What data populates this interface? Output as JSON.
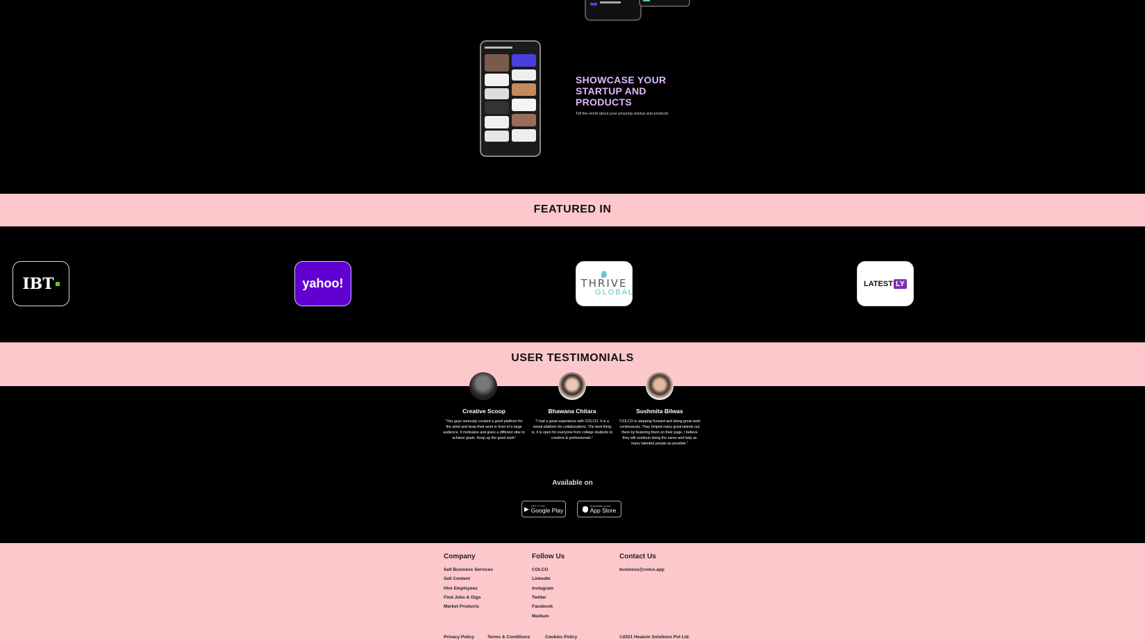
{
  "showcase": {
    "title": "SHOWCASE YOUR STARTUP AND PRODUCTS",
    "subtitle": "Tell the world about your amazing startup and products"
  },
  "featured": {
    "title": "FEATURED IN",
    "logos": [
      {
        "name": "IBT",
        "text": "IBT"
      },
      {
        "name": "yahoo",
        "text": "yahoo!"
      },
      {
        "name": "thrive-global",
        "text_a": "THRIVE",
        "text_b": "GLOBAL"
      },
      {
        "name": "latestly",
        "text": "LATEST",
        "badge": "LY"
      }
    ]
  },
  "testimonials": {
    "title": "USER TESTIMONIALS",
    "items": [
      {
        "name": "Creative Scoop",
        "quote": "\"You guys seriously created a good platform for the artist and keep their work in front of a large audience. It motivates and gives a different vibe to achieve goals. Keep up the good work\""
      },
      {
        "name": "Bhawana Chitara",
        "quote": "\"I had a great experience with COLCO. It is a social platform for collaborations. The best thing is, it is open for everyone from college students to creators & professionals.\""
      },
      {
        "name": "Sushmita Bilwas",
        "quote": "\"COLCO is stepping forward and doing great work continuously. They helped many great talents out there by featuring them on their page. I believe they will continue doing the same and help as many talented people as possible.\""
      }
    ]
  },
  "availability": {
    "label": "Available on",
    "google": {
      "small": "GET IT ON",
      "big": "Google Play"
    },
    "apple": {
      "small": "Download on the",
      "big": "App Store"
    }
  },
  "footer": {
    "company": {
      "heading": "Company",
      "links": [
        "Sell Business Services",
        "Sell Content",
        "Hire Employees",
        "Find Jobs & Gigs",
        "Market Products"
      ]
    },
    "follow": {
      "heading": "Follow Us",
      "links": [
        "COLCO",
        "LinkedIn",
        "Instagram",
        "Twitter",
        "Facebook",
        "Medium"
      ]
    },
    "contact": {
      "heading": "Contact Us",
      "email": "business@colco.app"
    },
    "legal": {
      "privacy": "Privacy Policy",
      "terms": "Terms & Conditions",
      "cookies": "Cookies Policy",
      "copyright": "©2021 Healum Solutions Pvt Ltd."
    }
  },
  "colors": {
    "band": "#fdc8cc",
    "accent": "#e3b7ff"
  }
}
